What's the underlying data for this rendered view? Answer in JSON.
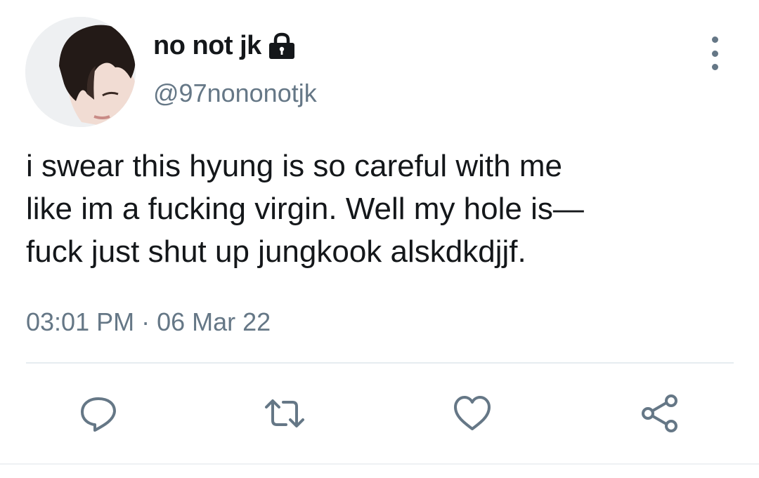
{
  "tweet": {
    "display_name": "no not jk",
    "handle": "@97nononotjk",
    "text": "i swear this hyung is so careful with me\nlike im a fucking virgin. Well my hole is—\nfuck just shut up jungkook alskdkdjjf.",
    "time": "03:01 PM",
    "separator": "·",
    "date": "06 Mar 22"
  },
  "icons": {
    "lock": "lock-icon",
    "more": "vertical-ellipsis-icon",
    "reply": "reply-icon",
    "retweet": "retweet-icon",
    "like": "heart-icon",
    "share": "share-icon"
  },
  "colors": {
    "text_primary": "#14171a",
    "text_secondary": "#657786",
    "icon": "#657786",
    "divider": "#e6ecf0"
  }
}
